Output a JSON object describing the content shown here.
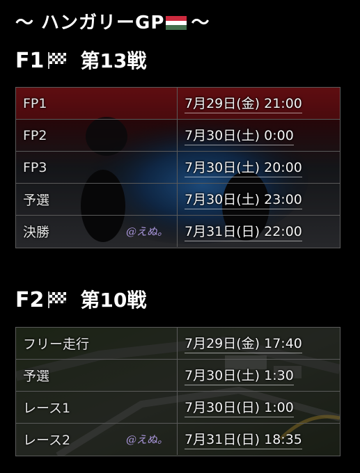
{
  "header": {
    "title_prefix": "〜 ハンガリーGP",
    "title_suffix": "〜",
    "flag_icon": "hungary-flag"
  },
  "f1": {
    "series": "F1",
    "round": "第13戦",
    "sessions": [
      {
        "name": "FP1",
        "time": "7月29日(金) 21:00"
      },
      {
        "name": "FP2",
        "time": "7月30日(土) 0:00"
      },
      {
        "name": "FP3",
        "time": "7月30日(土) 20:00"
      },
      {
        "name": "予選",
        "time": "7月30日(土) 23:00"
      },
      {
        "name": "決勝",
        "time": "7月31日(日) 22:00"
      }
    ],
    "watermark": "@えぬ。"
  },
  "f2": {
    "series": "F2",
    "round": "第10戦",
    "sessions": [
      {
        "name": "フリー走行",
        "time": "7月29日(金) 17:40"
      },
      {
        "name": "予選",
        "time": "7月30日(土) 1:30"
      },
      {
        "name": "レース1",
        "time": "7月30日(日) 1:00"
      },
      {
        "name": "レース2",
        "time": "7月31日(日) 18:35"
      }
    ],
    "watermark": "@えぬ。"
  },
  "colors": {
    "background": "#000000",
    "border": "#5a5a5a",
    "watermark": "#b9a3f0"
  }
}
